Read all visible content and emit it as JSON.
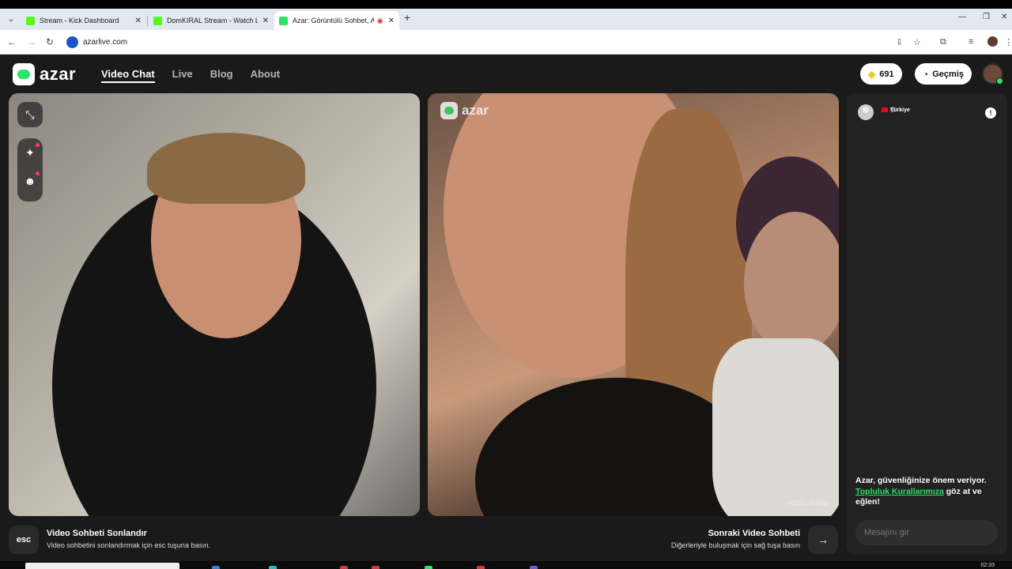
{
  "browser": {
    "tabs": [
      {
        "title": "Stream - Kick Dashboard",
        "favicon_color": "#53fc18",
        "active": false
      },
      {
        "title": "DomKIRAL Stream - Watch Live",
        "favicon_color": "#53fc18",
        "active": false
      },
      {
        "title": "Azar: Görüntülü Sohbet, Ar",
        "favicon_color": "#2fe06a",
        "active": true
      }
    ],
    "new_tab_label": "+",
    "url": "azarlive.com"
  },
  "header": {
    "logo_text": "azar",
    "nav": [
      {
        "label": "Video Chat",
        "active": true
      },
      {
        "label": "Live",
        "active": false
      },
      {
        "label": "Blog",
        "active": false
      },
      {
        "label": "About",
        "active": false
      }
    ],
    "gems_count": "691",
    "history_label": "Geçmiş"
  },
  "remote_video": {
    "watermark": "azar",
    "nickname": "oQUILLFUGgs"
  },
  "chat": {
    "country": "Türkiye",
    "safety_notice_prefix": "Azar, güvenliğinize önem veriyor.",
    "safety_link": "Topluluk Kurallarımıza",
    "safety_notice_suffix": "göz at ve eğlen!",
    "input_placeholder": "Mesajını gir"
  },
  "footer": {
    "esc_key": "esc",
    "end_title": "Video Sohbeti Sonlandır",
    "end_sub": "Video sohbetini sonlandırmak için esc tuşuna basın.",
    "next_title": "Sonraki Video Sohbeti",
    "next_sub": "Diğerleriyle buluşmak için sağ tuşa basın",
    "next_key": "→"
  },
  "taskbar": {
    "clock": "02:33"
  },
  "colors": {
    "accent": "#2fe06a",
    "background": "#1a1a1a",
    "alert_dot": "#ff3c5a"
  }
}
